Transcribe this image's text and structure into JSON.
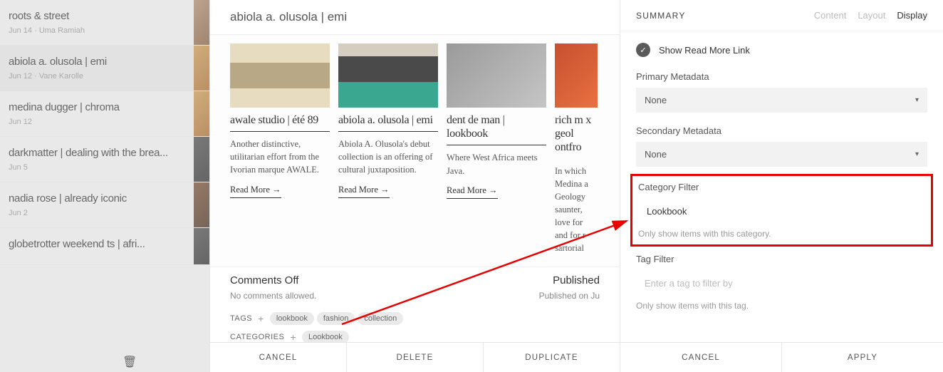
{
  "sidebar": {
    "posts": [
      {
        "title": "roots & street",
        "date": "Jun 14",
        "author": "Uma Ramiah"
      },
      {
        "title": "abiola a. olusola | emi",
        "date": "Jun 12",
        "author": "Vane Karolle",
        "selected": true
      },
      {
        "title": "medina dugger | chroma",
        "date": "Jun 12",
        "author": ""
      },
      {
        "title": "darkmatter | dealing with the brea...",
        "date": "Jun 5",
        "author": ""
      },
      {
        "title": "nadia rose | already iconic",
        "date": "Jun 2",
        "author": ""
      },
      {
        "title": "globetrotter weekend            ts | afri...",
        "date": "",
        "author": ""
      }
    ]
  },
  "editor": {
    "title_value": "abiola a. olusola | emi",
    "cards": [
      {
        "title": "awale studio | été 89",
        "desc": "Another distinctive, utilitarian effort from the Ivorian marque AWALE.",
        "read_more": "Read More →"
      },
      {
        "title": "abiola a. olusola | emi",
        "desc": "Abiola A. Olusola's debut collection is an offering of cultural juxtaposition.",
        "read_more": "Read More →"
      },
      {
        "title": "dent de man | lookbook",
        "desc": "Where West Africa meets Java.",
        "read_more": "Read More →"
      },
      {
        "title": "rich m   x geol ontfro",
        "desc": "In which Medina a Geology saunter, love for and for r sartorial",
        "read_more": ""
      }
    ],
    "comments_label": "Comments Off",
    "comments_sub": "No comments allowed.",
    "published_label": "Published",
    "published_sub": "Published on Ju",
    "tags_label": "TAGS",
    "tags": [
      "lookbook",
      "fashion",
      "collection"
    ],
    "cats_label": "CATEGORIES",
    "cats": [
      "Lookbook"
    ],
    "actions": {
      "cancel": "CANCEL",
      "delete": "DELETE",
      "duplicate": "DUPLICATE"
    }
  },
  "panel": {
    "heading": "SUMMARY",
    "tabs": {
      "content": "Content",
      "layout": "Layout",
      "display": "Display"
    },
    "show_read_more": "Show Read More Link",
    "primary_label": "Primary Metadata",
    "primary_value": "None",
    "secondary_label": "Secondary Metadata",
    "secondary_value": "None",
    "category_label": "Category Filter",
    "category_value": "Lookbook",
    "category_help": "Only show items with this category.",
    "tag_label": "Tag Filter",
    "tag_placeholder": "Enter a tag to filter by",
    "tag_help": "Only show items with this tag.",
    "actions": {
      "cancel": "CANCEL",
      "apply": "APPLY"
    }
  }
}
